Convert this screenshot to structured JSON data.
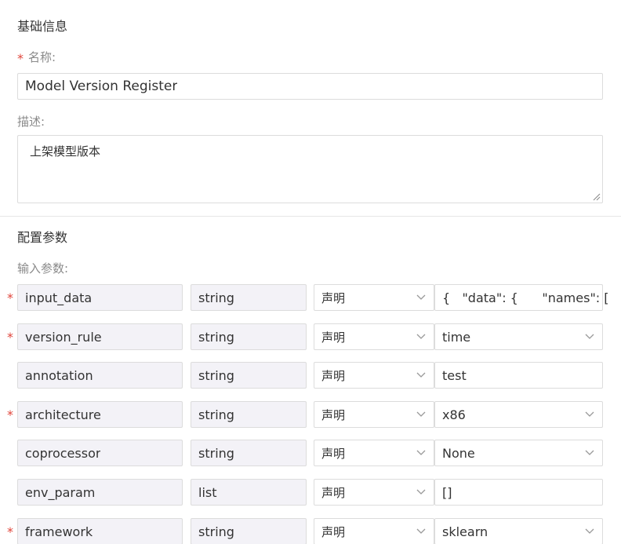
{
  "basic": {
    "title": "基础信息",
    "required_mark": "*",
    "name_label": "名称:",
    "name_value": "Model Version Register",
    "desc_label": "描述:",
    "desc_value": "上架模型版本"
  },
  "config": {
    "title": "配置参数",
    "input_label": "输入参数:",
    "params": [
      {
        "required": true,
        "name": "input_data",
        "type": "string",
        "mode": "声明",
        "value": "{   \"data\": {      \"names\": [",
        "value_is_select": false
      },
      {
        "required": true,
        "name": "version_rule",
        "type": "string",
        "mode": "声明",
        "value": "time",
        "value_is_select": true
      },
      {
        "required": false,
        "name": "annotation",
        "type": "string",
        "mode": "声明",
        "value": "test",
        "value_is_select": false
      },
      {
        "required": true,
        "name": "architecture",
        "type": "string",
        "mode": "声明",
        "value": "x86",
        "value_is_select": true
      },
      {
        "required": false,
        "name": "coprocessor",
        "type": "string",
        "mode": "声明",
        "value": "None",
        "value_is_select": true
      },
      {
        "required": false,
        "name": "env_param",
        "type": "list",
        "mode": "声明",
        "value": "[]",
        "value_is_select": false
      },
      {
        "required": true,
        "name": "framework",
        "type": "string",
        "mode": "声明",
        "value": "sklearn",
        "value_is_select": true
      }
    ]
  },
  "colors": {
    "required": "#e0453b",
    "readonly_bg": "#f3f2f7",
    "border": "#dcdcdc"
  }
}
